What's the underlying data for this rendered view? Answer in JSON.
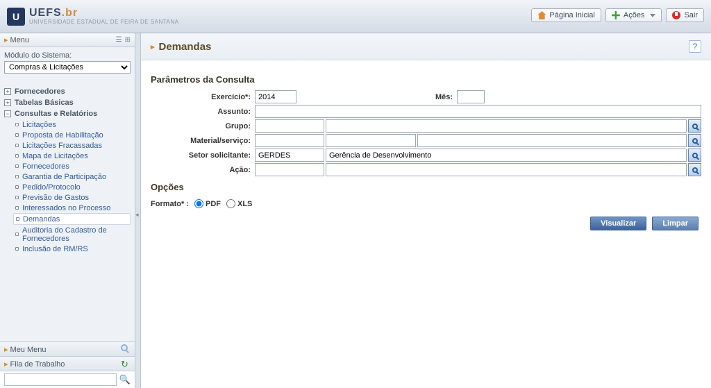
{
  "header": {
    "logo_main": "UEFS",
    "logo_suffix": ".br",
    "logo_subtitle": "UNIVERSIDADE ESTADUAL DE FEIRA DE SANTANA",
    "btn_home": "Página Inicial",
    "btn_actions": "Ações",
    "btn_exit": "Sair"
  },
  "sidebar": {
    "menu_title": "Menu",
    "module_label": "Módulo do Sistema:",
    "module_value": "Compras & Licitações",
    "tree": {
      "fornecedores": "Fornecedores",
      "tabelas": "Tabelas Básicas",
      "consultas": "Consultas e Relatórios"
    },
    "sub": [
      "Licitações",
      "Proposta de Habilitação",
      "Licitações Fracassadas",
      "Mapa de Licitações",
      "Fornecedores",
      "Garantia de Participação",
      "Pedido/Protocolo",
      "Previsão de Gastos",
      "Interessados no Processo",
      "Demandas",
      "Auditoria do Cadastro de Fornecedores",
      "Inclusão de RM/RS"
    ],
    "meu_menu": "Meu Menu",
    "fila": "Fila de Trabalho",
    "search_placeholder": ""
  },
  "page": {
    "title": "Demandas",
    "section_params": "Parâmetros da Consulta",
    "labels": {
      "exercicio": "Exercício*:",
      "mes": "Mês:",
      "assunto": "Assunto:",
      "grupo": "Grupo:",
      "material": "Material/serviço:",
      "setor": "Setor solicitante:",
      "acao": "Ação:"
    },
    "values": {
      "exercicio": "2014",
      "mes": "",
      "assunto": "",
      "grupo_code": "",
      "grupo_desc": "",
      "material_code": "",
      "material_mid": "",
      "material_desc": "",
      "setor_code": "GERDES",
      "setor_desc": "Gerência de Desenvolvimento",
      "acao_code": "",
      "acao_desc": ""
    },
    "section_options": "Opções",
    "format_label": "Formato* :",
    "format_pdf": "PDF",
    "format_xls": "XLS",
    "btn_visualizar": "Visualizar",
    "btn_limpar": "Limpar"
  }
}
